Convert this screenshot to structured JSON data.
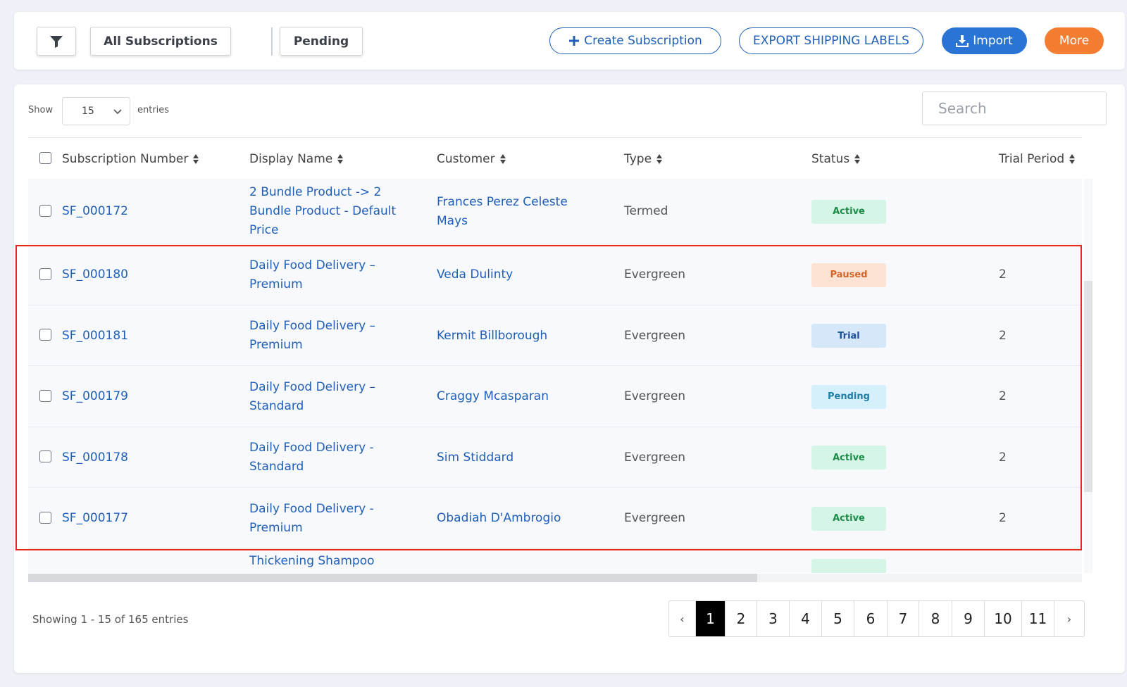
{
  "toolbar": {
    "all_subscriptions": "All Subscriptions",
    "pending": "Pending",
    "create_subscription": "Create Subscription",
    "export_shipping_labels": "EXPORT SHIPPING LABELS",
    "import": "Import",
    "more": "More"
  },
  "controls": {
    "show_label": "Show",
    "entries_per_page": "15",
    "entries_label": "entries",
    "search_placeholder": "Search"
  },
  "table": {
    "columns": [
      "Subscription Number",
      "Display Name",
      "Customer",
      "Type",
      "Status",
      "Trial Period"
    ],
    "rows": [
      {
        "number": "SF_000172",
        "display_name": [
          "2 Bundle Product -> 2",
          "Bundle Product - Default",
          "Price"
        ],
        "customer": [
          "Frances Perez Celeste",
          "Mays"
        ],
        "type": "Termed",
        "status": "Active",
        "trial_period": ""
      },
      {
        "number": "SF_000180",
        "display_name": [
          "Daily Food Delivery –",
          "Premium"
        ],
        "customer": [
          "Veda Dulinty"
        ],
        "type": "Evergreen",
        "status": "Paused",
        "trial_period": "2"
      },
      {
        "number": "SF_000181",
        "display_name": [
          "Daily Food Delivery –",
          "Premium"
        ],
        "customer": [
          "Kermit Billborough"
        ],
        "type": "Evergreen",
        "status": "Trial",
        "trial_period": "2"
      },
      {
        "number": "SF_000179",
        "display_name": [
          "Daily Food Delivery –",
          "Standard"
        ],
        "customer": [
          "Craggy Mcasparan"
        ],
        "type": "Evergreen",
        "status": "Pending",
        "trial_period": "2"
      },
      {
        "number": "SF_000178",
        "display_name": [
          "Daily Food Delivery -",
          "Standard"
        ],
        "customer": [
          "Sim Stiddard"
        ],
        "type": "Evergreen",
        "status": "Active",
        "trial_period": "2"
      },
      {
        "number": "SF_000177",
        "display_name": [
          "Daily Food Delivery -",
          "Premium"
        ],
        "customer": [
          "Obadiah D'Ambrogio"
        ],
        "type": "Evergreen",
        "status": "Active",
        "trial_period": "2"
      },
      {
        "number": "",
        "display_name": [
          "Thickening Shampoo"
        ],
        "customer": [
          ""
        ],
        "type": "",
        "status": "Active",
        "trial_period": ""
      }
    ]
  },
  "status_colors": {
    "Active": {
      "bg": "#d5f5e6",
      "fg": "#1e8a4a"
    },
    "Paused": {
      "bg": "#fde3d3",
      "fg": "#d2662a"
    },
    "Trial": {
      "bg": "#d6e6fb",
      "fg": "#1c4f9a"
    },
    "Pending": {
      "bg": "#d6f0fb",
      "fg": "#1f7ea8"
    }
  },
  "footer": {
    "showing_text": "Showing 1 - 15 of 165 entries",
    "pages": [
      "1",
      "2",
      "3",
      "4",
      "5",
      "6",
      "7",
      "8",
      "9",
      "10",
      "11"
    ],
    "current_page": "1",
    "prev_symbol": "‹",
    "next_symbol": "›"
  }
}
